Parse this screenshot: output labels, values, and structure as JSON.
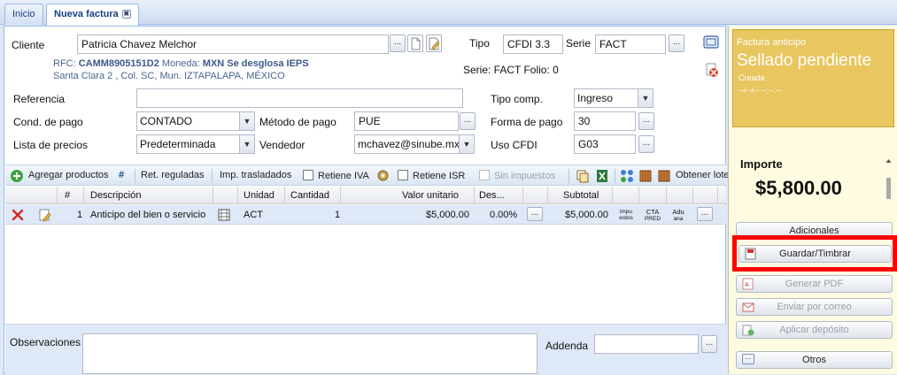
{
  "tabs": [
    {
      "label": "Inicio"
    },
    {
      "label": "Nueva factura",
      "close": "✖"
    }
  ],
  "customer": {
    "label": "Cliente",
    "value": "Patricia Chavez Melchor",
    "rfc_label": "RFC:",
    "rfc": "CAMM8905151D2",
    "moneda_label": "Moneda:",
    "moneda": "MXN Se desglosa IEPS",
    "address": "Santa Clara 2 , Col. SC, Mun. IZTAPALAPA, MÉXICO"
  },
  "tipo": {
    "label": "Tipo",
    "value": "CFDI 3.3"
  },
  "serie": {
    "label": "Serie",
    "value": "FACT",
    "info": "Serie: FACT Folio: 0"
  },
  "referencia": {
    "label": "Referencia",
    "value": ""
  },
  "tipo_comp": {
    "label": "Tipo comp.",
    "value": "Ingreso"
  },
  "cond_pago": {
    "label": "Cond. de pago",
    "value": "CONTADO"
  },
  "metodo_pago": {
    "label": "Método de pago",
    "value": "PUE"
  },
  "forma_pago": {
    "label": "Forma de pago",
    "value": "30"
  },
  "lista_precios": {
    "label": "Lista de precios",
    "value": "Predeterminada"
  },
  "vendedor": {
    "label": "Vendedor",
    "value": "mchavez@sinube.mx"
  },
  "uso_cfdi": {
    "label": "Uso CFDI",
    "value": "G03"
  },
  "ellipsis": "...",
  "toolbar": {
    "add_products": "Agregar productos",
    "hash": "#",
    "ret_reguladas": "Ret. reguladas",
    "imp_trasladados": "Imp. trasladados",
    "retiene_iva": "Retiene IVA",
    "retiene_isr": "Retiene ISR",
    "sin_impuestos": "Sin impuestos",
    "obtener": "Obtener lote"
  },
  "grid": {
    "headers": [
      "#",
      "Descripción",
      "Unidad",
      "Cantidad",
      "Valor unitario",
      "Des...",
      "Subtotal"
    ],
    "rows": [
      {
        "num": "1",
        "desc": "Anticipo del bien o servicio",
        "unidad": "ACT",
        "cantidad": "1",
        "valor": "$5,000.00",
        "desc_pct": "0.00%",
        "subtotal": "$5,000.00",
        "impuestos": "impu estos",
        "cta_a": "CTA",
        "cta_b": "PRED",
        "aduana_a": "Adu",
        "aduana_b": "ana"
      }
    ]
  },
  "observaciones": {
    "label": "Observaciones",
    "value": ""
  },
  "addenda": {
    "label": "Addenda",
    "value": ""
  },
  "status": {
    "type": "Factura anticipo",
    "title": "Sellado pendiente",
    "sub": "Creada",
    "date": "--/--/-- --:--:--"
  },
  "importe": {
    "label": "Importe",
    "value": "$5,800.00"
  },
  "actions": {
    "adicionales": "Adicionales",
    "guardar": "Guardar/Timbrar",
    "pdf": "Generar PDF",
    "correo": "Enviar por correo",
    "deposito": "Aplicar depósito",
    "otros": "Otros"
  },
  "colors": {
    "status_bg": "#e8c660",
    "highlight": "#ff0000",
    "link": "#15428b"
  }
}
